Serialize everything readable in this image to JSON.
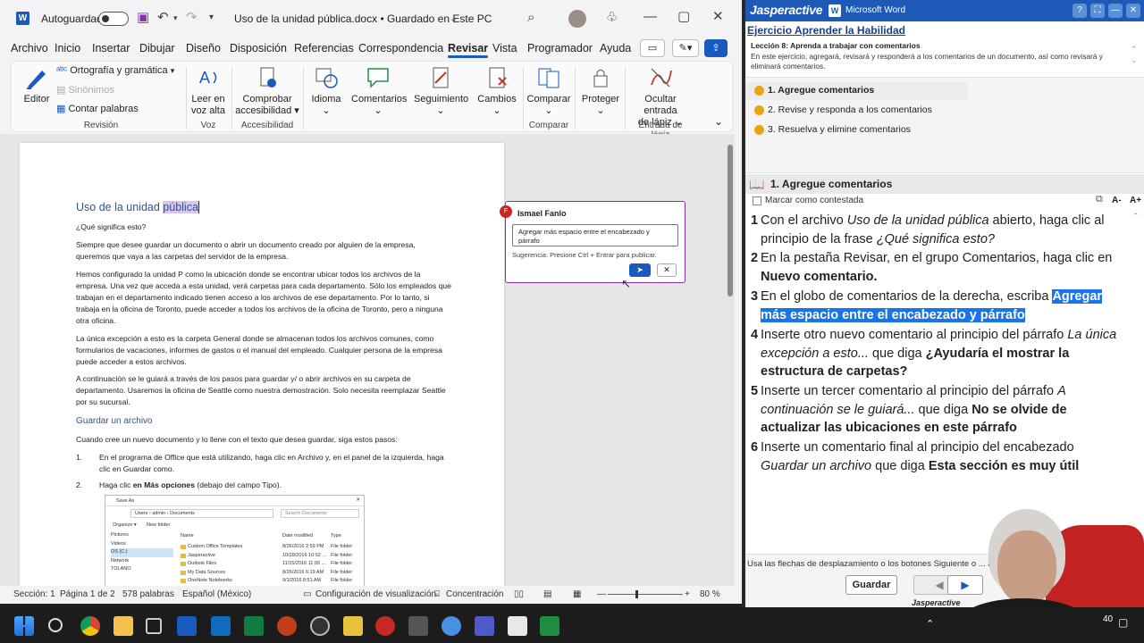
{
  "word": {
    "autosave_label": "Autoguardado",
    "doc_title": "Uso de la unidad pública.docx • Guardado en Este PC",
    "menu": [
      "Archivo",
      "Inicio",
      "Insertar",
      "Dibujar",
      "Diseño",
      "Disposición",
      "Referencias",
      "Correspondencia",
      "Revisar",
      "Vista",
      "Programador",
      "Ayuda"
    ],
    "active_menu": "Revisar",
    "ribbon": {
      "editor": "Editor",
      "spelling": "Ortografía y gramática",
      "synonyms": "Sinónimos",
      "wordcount": "Contar palabras",
      "read_aloud_1": "Leer en",
      "read_aloud_2": "voz alta",
      "accessibility_1": "Comprobar",
      "accessibility_2": "accesibilidad",
      "language": "Idioma",
      "comments": "Comentarios",
      "tracking": "Seguimiento",
      "changes": "Cambios",
      "compare": "Comparar",
      "protect": "Proteger",
      "ink_1": "Ocultar entrada",
      "ink_2": "de lápiz",
      "groups": {
        "revision": "Revisión",
        "voice": "Voz",
        "accessibility": "Accesibilidad",
        "compare": "Comparar",
        "ink": "Entrada de lápiz"
      }
    },
    "document": {
      "title_a": "Uso de la unidad ",
      "title_b": "pública",
      "q": "¿Qué significa esto?",
      "p1": "Siempre que desee guardar un documento o abrir un documento creado por alguien de la empresa, queremos que vaya a las carpetas del servidor de la empresa.",
      "p2": "Hemos configurado la unidad P como la ubicación donde se encontrar ubicar todos los archivos de la empresa. Una vez que acceda a esta unidad, verá carpetas para cada departamento. Sólo los empleados que trabajan en el departamento indicado tienen acceso a los archivos de ese departamento. Por lo tanto, si trabaja en la oficina de Toronto, puede acceder a todos los archivos de la oficina de Toronto, pero a ninguna otra oficina.",
      "p3": "La única excepción a esto es la carpeta General donde se almacenan todos los archivos comunes, como formularios de vacaciones, informes de gastos o el manual del empleado. Cualquier persona de la empresa puede acceder a estos archivos.",
      "p4": "A continuación se le guiará a través de los pasos para guardar y/ o abrir archivos en su carpeta de departamento. Usaremos la oficina de Seattle como nuestra demostración. Solo necesita reemplazar Seattle por su sucursal.",
      "h2": "Guardar un archivo",
      "p5": "Cuando cree un nuevo documento y lo llene con el texto que desea guardar, siga estos pasos:",
      "li1_num": "1.",
      "li1": "En el programa de Office que está utilizando, haga clic en Archivo y, en el panel de la izquierda, haga clic en Guardar como.",
      "li2_num": "2.",
      "li2_a": "Haga clic ",
      "li2_b": "en Más opciones",
      "li2_c": " (debajo del campo Tipo).",
      "dialog": {
        "title": "Save As",
        "path": "Users  ›  admin  ›  Documents",
        "search": "Search Documents",
        "organize": "Organize ▾",
        "new_folder": "New folder",
        "nav": [
          "Pictures",
          "Videos",
          "OS (C:)",
          "Network",
          "TOLANO"
        ],
        "cols": [
          "Name",
          "Date modified",
          "Type"
        ],
        "rows": [
          [
            "Custom Office Templates",
            "8/26/2016 2:59 PM",
            "File folder"
          ],
          [
            "Jasperactive",
            "10/28/2016 10:52 ...",
            "File folder"
          ],
          [
            "Outlook Files",
            "11/15/2016 11:00 ...",
            "File folder"
          ],
          [
            "My Data Sources",
            "8/26/2016 6:19 AM",
            "File folder"
          ],
          [
            "OneNote Notebooks",
            "9/1/2016 8:51 AM",
            "File folder"
          ]
        ]
      }
    },
    "comment": {
      "author": "Ismael Fanlo",
      "initial": "F",
      "text": "Agregar más espacio entre el encabezado y párrafo",
      "hint": "Sugerencia: Presione Ctrl + Entrar para publicar."
    },
    "status": {
      "section": "Sección: 1",
      "page": "Página 1 de 2",
      "words": "578 palabras",
      "lang": "Español (México)",
      "view_settings": "Configuración de visualización",
      "focus": "Concentración",
      "zoom": "80 %"
    }
  },
  "jasper": {
    "brand": "Jasperactive",
    "product": "Microsoft Word",
    "exercise_title": "Ejercicio Aprender la Habilidad",
    "lesson": "Lección 8: Aprenda a trabajar con comentarios",
    "lesson_desc": "En este ejercicio, agregará, revisará y responderá a los comentarios de un documento, así como revisará y eliminará comentarios.",
    "tasks": [
      "1. Agregue comentarios",
      "2. Revise y responda a los comentarios",
      "3. Resuelva y elimine comentarios"
    ],
    "current_task": "1. Agregue comentarios",
    "mark_answered": "Marcar como contestada",
    "font_minus": "A-",
    "font_plus": "A+",
    "steps": [
      {
        "n": "1",
        "html": "Con el archivo <i>Uso de la unidad pública</i> abierto, haga clic al principio de la frase <i>¿Qué significa esto?</i>"
      },
      {
        "n": "2",
        "html": "En la pestaña Revisar, en el grupo Comentarios, haga clic en <b>Nuevo comentario.</b>"
      },
      {
        "n": "3",
        "html": "En el globo de comentarios de la derecha, escriba <b class=\"hl\">Agregar más espacio entre el encabezado y párrafo</b>"
      },
      {
        "n": "4",
        "html": "Inserte otro nuevo comentario al principio del párrafo <i>La única excepción a esto...</i> que diga <b>¿Ayudaría el mostrar la estructura de carpetas?</b>"
      },
      {
        "n": "5",
        "html": "Inserte un tercer comentario al principio del párrafo <i>A continuación se le guiará...</i> que diga <b>No se olvide de actualizar las ubicaciones en este párrafo</b>"
      },
      {
        "n": "6",
        "html": "Inserte un comentario final al principio del encabezado <i>Guardar un archivo</i> que diga <b>Esta sección es muy útil</b>"
      }
    ],
    "footer_hint": "Usa las flechas de desplazamiento o los botones Siguiente o ... ar.",
    "save_button": "Guardar",
    "footer_brand": "Jasperactive"
  },
  "taskbar": {
    "clock": "40"
  },
  "colors": {
    "word_blue": "#185abd",
    "jasper_blue": "#1d5ab8",
    "comment_border": "#8a2db5",
    "highlight": "#1a73e8"
  }
}
